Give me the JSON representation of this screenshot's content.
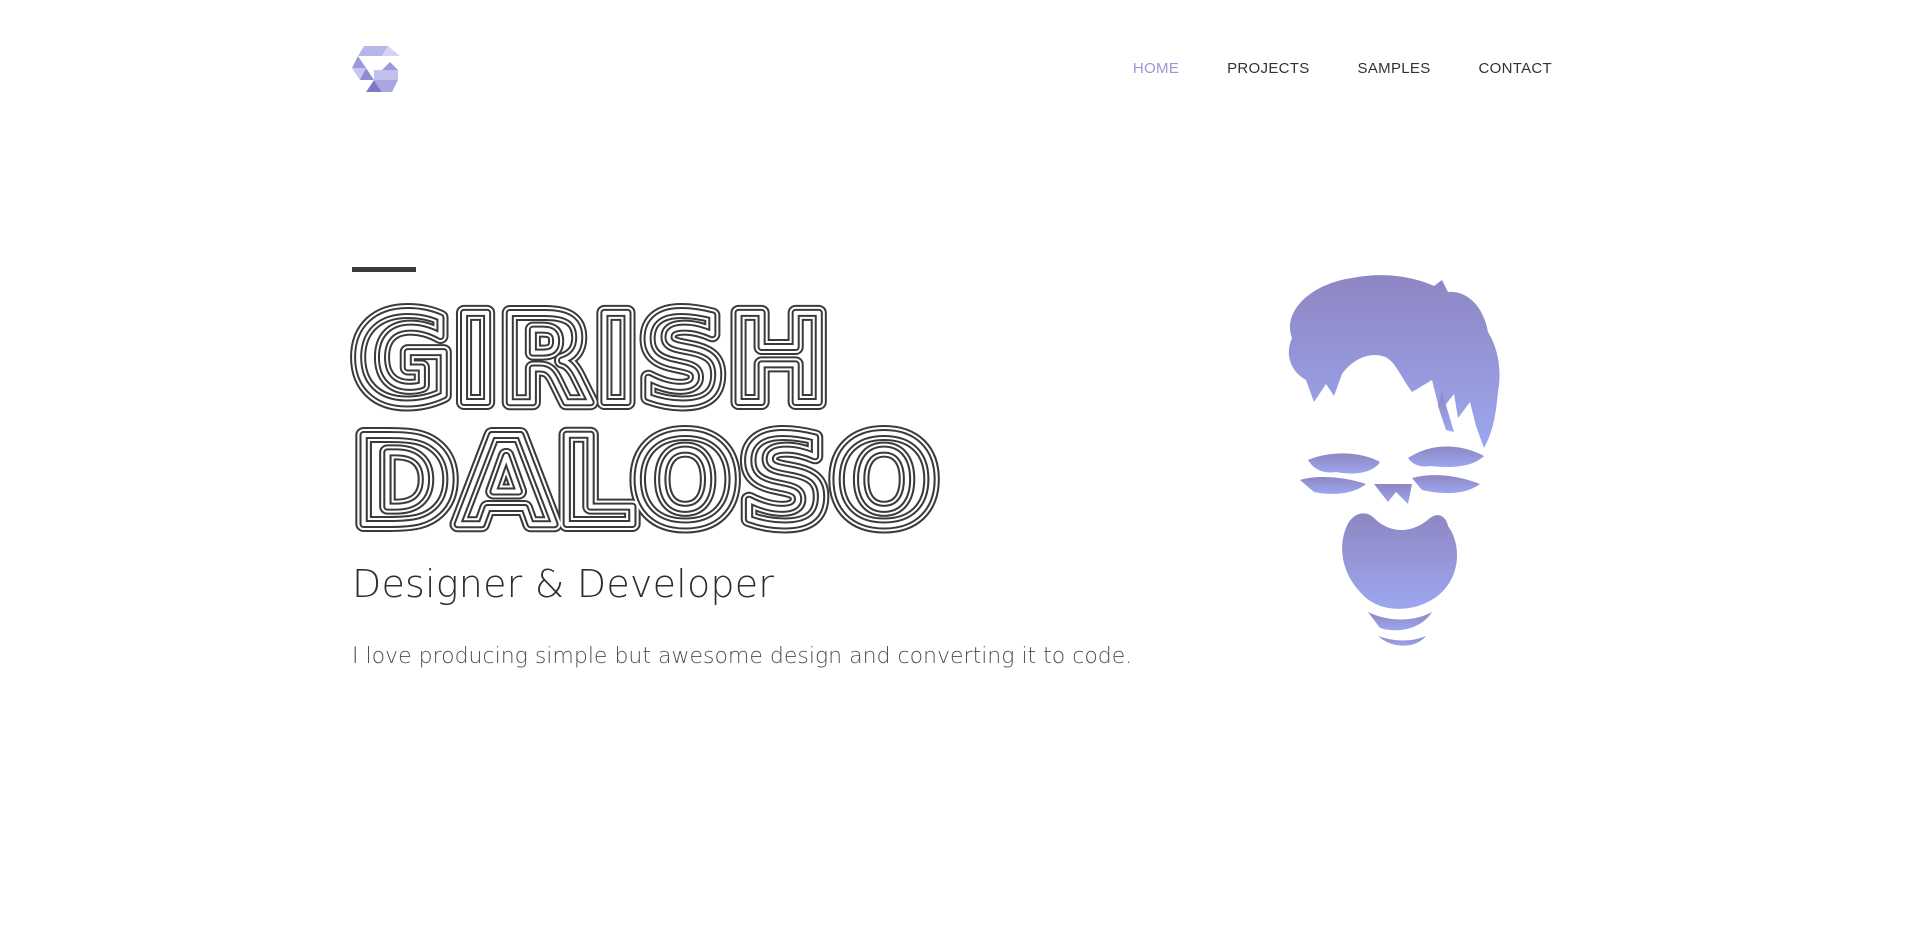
{
  "brand": {
    "logo_icon": "stacked-g-logo-icon",
    "accent_color": "#9a97d6"
  },
  "nav": {
    "items": [
      {
        "label": "HOME",
        "active": true
      },
      {
        "label": "PROJECTS",
        "active": false
      },
      {
        "label": "SAMPLES",
        "active": false
      },
      {
        "label": "CONTACT",
        "active": false
      }
    ]
  },
  "hero": {
    "first_name": "GIRISH",
    "last_name": "DALOSO",
    "role": "Designer & Developer",
    "tagline": "I love producing simple but awesome design and converting it to code.",
    "portrait_icon": "face-illustration-icon",
    "text_color": "#3a3a3a"
  }
}
